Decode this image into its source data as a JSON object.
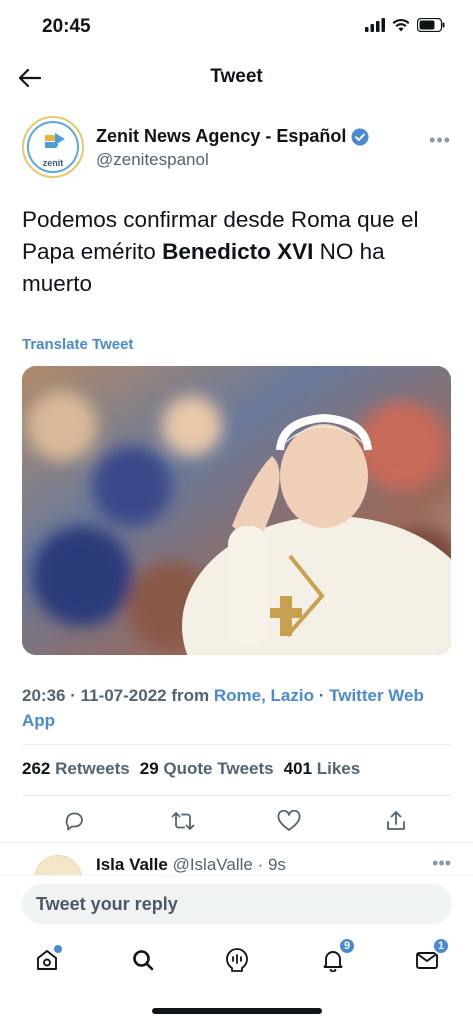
{
  "status_bar": {
    "time": "20:45"
  },
  "header": {
    "title": "Tweet"
  },
  "author": {
    "name": "Zenit News Agency - Español",
    "handle": "@zenitespanol",
    "avatar_text": "zenit"
  },
  "tweet": {
    "text_before": "Podemos confirmar desde Roma que el Papa emérito ",
    "text_bold": "Benedicto XVI",
    "text_after": " NO ha muerto",
    "translate_label": "Translate Tweet"
  },
  "meta": {
    "time": "20:36",
    "date": "11-07-2022",
    "from_label": "from",
    "location": "Rome, Lazio",
    "source": "Twitter Web App"
  },
  "stats": {
    "retweets_count": "262",
    "retweets_label": "Retweets",
    "quotes_count": "29",
    "quotes_label": "Quote Tweets",
    "likes_count": "401",
    "likes_label": "Likes"
  },
  "reply_preview": {
    "name": "Isla Valle",
    "handle": "@IslaValle",
    "time": "9s"
  },
  "reply_bar": {
    "placeholder": "Tweet your reply"
  },
  "tabbar": {
    "notifications_badge": "9",
    "messages_badge": "1"
  },
  "colors": {
    "accent": "#4a8ad1",
    "text": "#0f1419",
    "muted": "#536471"
  }
}
